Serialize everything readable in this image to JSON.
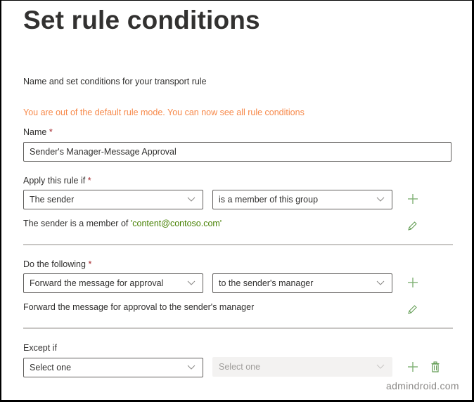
{
  "page": {
    "title": "Set rule conditions",
    "subtitle": "Name and set conditions for your transport rule",
    "warning": "You are out of the default rule mode. You can now see all rule conditions"
  },
  "name_field": {
    "label": "Name",
    "required_marker": "*",
    "value": "Sender's Manager-Message Approval"
  },
  "apply_rule": {
    "label": "Apply this rule if",
    "required_marker": "*",
    "condition_select": "The sender",
    "operator_select": "is a member of this group",
    "description_prefix": "The sender is a member of ",
    "description_value": "'content@contoso.com'",
    "add_icon": "plus-icon",
    "edit_icon": "pencil-icon"
  },
  "do_following": {
    "label": "Do the following",
    "required_marker": "*",
    "action_select": "Forward the message for approval",
    "target_select": "to the sender's manager",
    "description": "Forward the message for approval to the sender's manager",
    "add_icon": "plus-icon",
    "edit_icon": "pencil-icon"
  },
  "except_if": {
    "label": "Except if",
    "condition_select": "Select one",
    "operator_select": "Select one",
    "operator_disabled": true,
    "add_icon": "plus-icon",
    "delete_icon": "trash-icon"
  },
  "watermark": "admindroid.com",
  "colors": {
    "accent_green": "#498205",
    "icon_green": "#7fb174",
    "warning_orange": "#f7894a",
    "required_red": "#a4262c"
  }
}
